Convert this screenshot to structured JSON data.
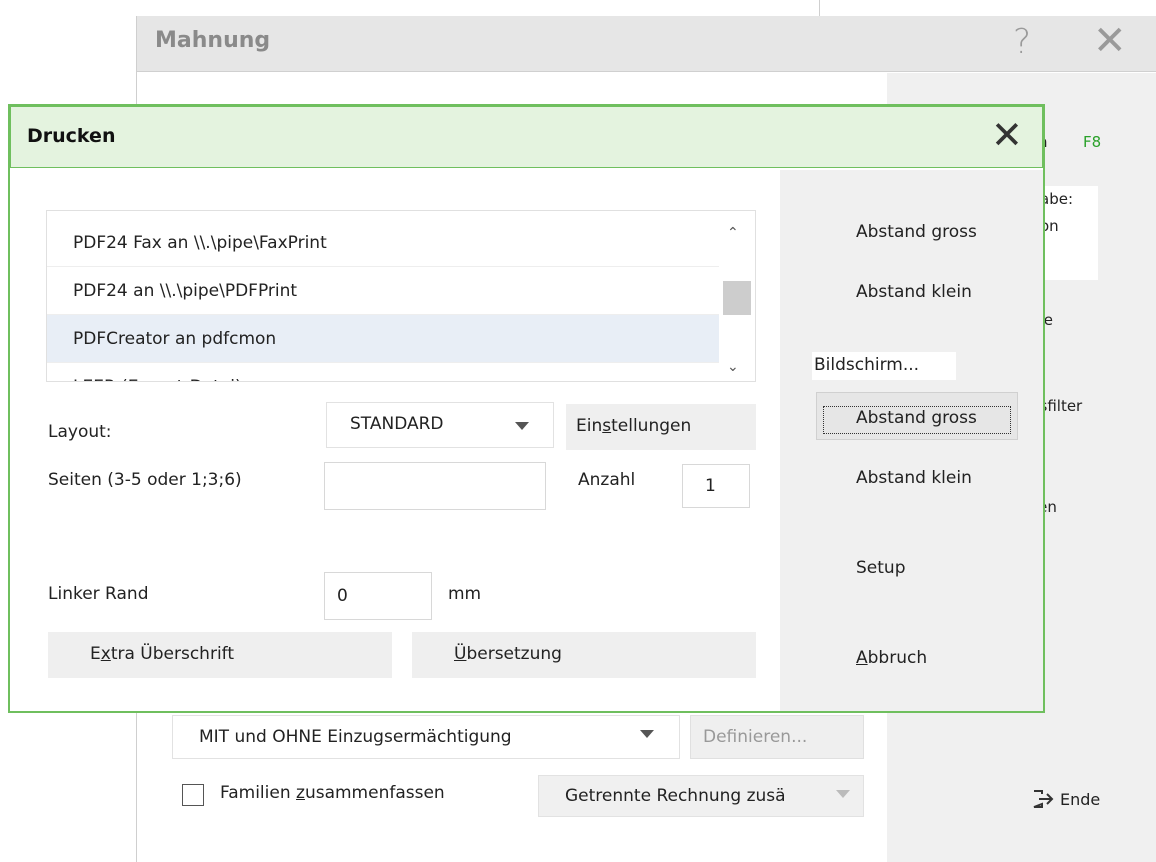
{
  "mahnung": {
    "title": "Mahnung",
    "help_glyph": "?",
    "close_glyph": "✕",
    "side_fragments": {
      "n": "n",
      "f8": "F8",
      "abe": "abe:",
      "on": "on",
      "ste": "ste",
      "gsfilter": "gsfilter",
      "ken": "ken"
    },
    "ende_label": "Ende",
    "einzug_value": "MIT und OHNE Einzugsermächtigung",
    "definieren_label": "Definieren...",
    "familien_label_pre": "Familien ",
    "familien_label_u": "z",
    "familien_label_post": "usammenfassen",
    "getrennt_value": "Getrennte Rechnung zusä"
  },
  "drucken": {
    "title": "Drucken",
    "close_glyph": "✕",
    "printers": [
      {
        "label": "PDF24 Fax an \\\\.\\pipe\\FaxPrint"
      },
      {
        "label": "PDF24 an \\\\.\\pipe\\PDFPrint"
      },
      {
        "label": "PDFCreator an pdfcmon"
      },
      {
        "label": "LEER (Export-Datei)"
      }
    ],
    "layout_label": "Layout:",
    "layout_value": "STANDARD",
    "einstellungen_pre": "Ein",
    "einstellungen_u": "s",
    "einstellungen_post": "tellungen",
    "seiten_label": "Seiten (3-5 oder 1;3;6)",
    "seiten_value": "",
    "anzahl_label": "Anzahl",
    "anzahl_value": "1",
    "rand_label": "Linker Rand",
    "rand_value": "0",
    "rand_unit": "mm",
    "extra_pre": "E",
    "extra_u": "x",
    "extra_post": "tra Überschrift",
    "uebers_u": "Ü",
    "uebers_post": "bersetzung",
    "side": {
      "abstand_gross_1": "Abstand gross",
      "abstand_klein_1": "Abstand klein",
      "bildschirm": "Bildschirm...",
      "abstand_gross_2": "Abstand gross",
      "abstand_klein_2": "Abstand klein",
      "setup": "Setup",
      "abbruch_u": "A",
      "abbruch_post": "bbruch"
    }
  }
}
